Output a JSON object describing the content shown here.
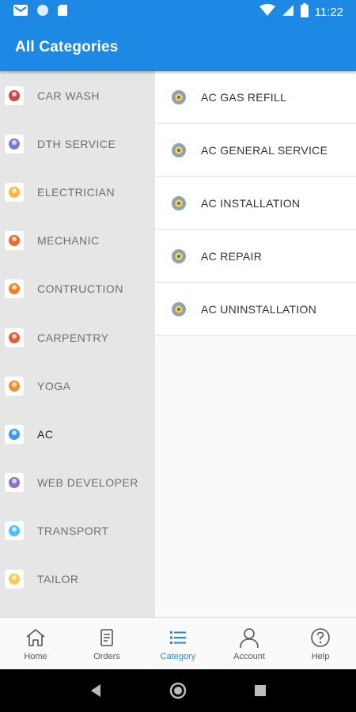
{
  "status_bar": {
    "time": "11:22",
    "left_icons": [
      "gmail-icon",
      "circle-icon",
      "sd-card-icon"
    ],
    "right_icons": [
      "wifi-icon",
      "signal-icon",
      "battery-icon"
    ]
  },
  "app_bar": {
    "title": "All Categories"
  },
  "sidebar": {
    "items": [
      {
        "label": "CAR WASH",
        "icon": "car-wash-icon",
        "color": "#c62828"
      },
      {
        "label": "DTH SERVICE",
        "icon": "dth-icon",
        "color": "#5c6bc0"
      },
      {
        "label": "ELECTRICIAN",
        "icon": "electrician-icon",
        "color": "#f9a825"
      },
      {
        "label": "MECHANIC",
        "icon": "mechanic-icon",
        "color": "#e65100"
      },
      {
        "label": "CONTRUCTION",
        "icon": "construction-icon",
        "color": "#ef6c00"
      },
      {
        "label": "CARPENTRY",
        "icon": "carpentry-icon",
        "color": "#d84315"
      },
      {
        "label": "YOGA",
        "icon": "yoga-icon",
        "color": "#f57c00"
      },
      {
        "label": "AC",
        "icon": "ac-icon",
        "color": "#1e88e5",
        "active": true
      },
      {
        "label": "WEB DEVELOPER",
        "icon": "web-developer-icon",
        "color": "#7e57c2"
      },
      {
        "label": "TRANSPORT",
        "icon": "transport-icon",
        "color": "#29b6f6"
      },
      {
        "label": "TAILOR",
        "icon": "tailor-icon",
        "color": "#fbc02d"
      }
    ]
  },
  "subcategories": {
    "items": [
      {
        "label": "AC GAS REFILL"
      },
      {
        "label": "AC GENERAL SERVICE"
      },
      {
        "label": "AC INSTALLATION"
      },
      {
        "label": "AC REPAIR"
      },
      {
        "label": "AC UNINSTALLATION"
      }
    ]
  },
  "bottom_nav": {
    "items": [
      {
        "label": "Home",
        "icon": "home-icon"
      },
      {
        "label": "Orders",
        "icon": "orders-icon"
      },
      {
        "label": "Category",
        "icon": "category-icon",
        "active": true
      },
      {
        "label": "Account",
        "icon": "account-icon"
      },
      {
        "label": "Help",
        "icon": "help-icon"
      }
    ]
  },
  "colors": {
    "primary": "#1e88e5",
    "sidebar_bg": "#e6e6e6"
  }
}
